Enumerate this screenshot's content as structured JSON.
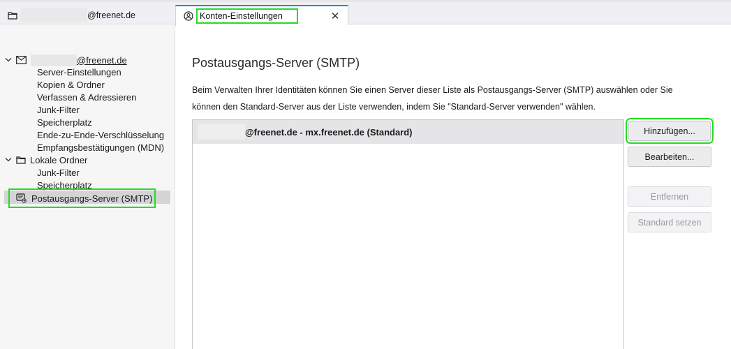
{
  "tabs": [
    {
      "title_suffix": "@freenet.de",
      "icon": "folder-icon"
    },
    {
      "title": "Konten-Einstellungen",
      "icon": "account-settings-icon",
      "close": "✕"
    }
  ],
  "sidebar": {
    "account": {
      "label_suffix": "@freenet.de",
      "expanded": true,
      "icon": "mail-account-icon"
    },
    "account_children": [
      "Server-Einstellungen",
      "Kopien & Ordner",
      "Verfassen & Adressieren",
      "Junk-Filter",
      "Speicherplatz",
      "Ende-zu-Ende-Verschlüsselung",
      "Empfangsbestätigungen (MDN)"
    ],
    "local_folders": {
      "label": "Lokale Ordner",
      "expanded": true,
      "icon": "folder-icon"
    },
    "local_children": [
      "Junk-Filter",
      "Speicherplatz"
    ],
    "smtp": {
      "label": "Postausgangs-Server (SMTP)",
      "icon": "outgoing-server-icon",
      "selected": true
    }
  },
  "main": {
    "heading": "Postausgangs-Server (SMTP)",
    "description": "Beim Verwalten Ihrer Identitäten können Sie einen Server dieser Liste als Postausgangs-Server (SMTP) auswählen oder Sie können den Standard-Server aus der Liste verwenden, indem Sie \"Standard-Server verwenden\" wählen.",
    "servers": [
      {
        "label": "@freenet.de - mx.freenet.de (Standard)",
        "selected": true
      }
    ],
    "buttons": {
      "add": "Hinzufügen...",
      "edit": "Bearbeiten...",
      "remove": "Entfernen",
      "set_default": "Standard setzen"
    }
  },
  "colors": {
    "highlight": "#22dd22",
    "active_tab_accent": "#0a84ff",
    "selected_row": "#d4d4d6"
  }
}
